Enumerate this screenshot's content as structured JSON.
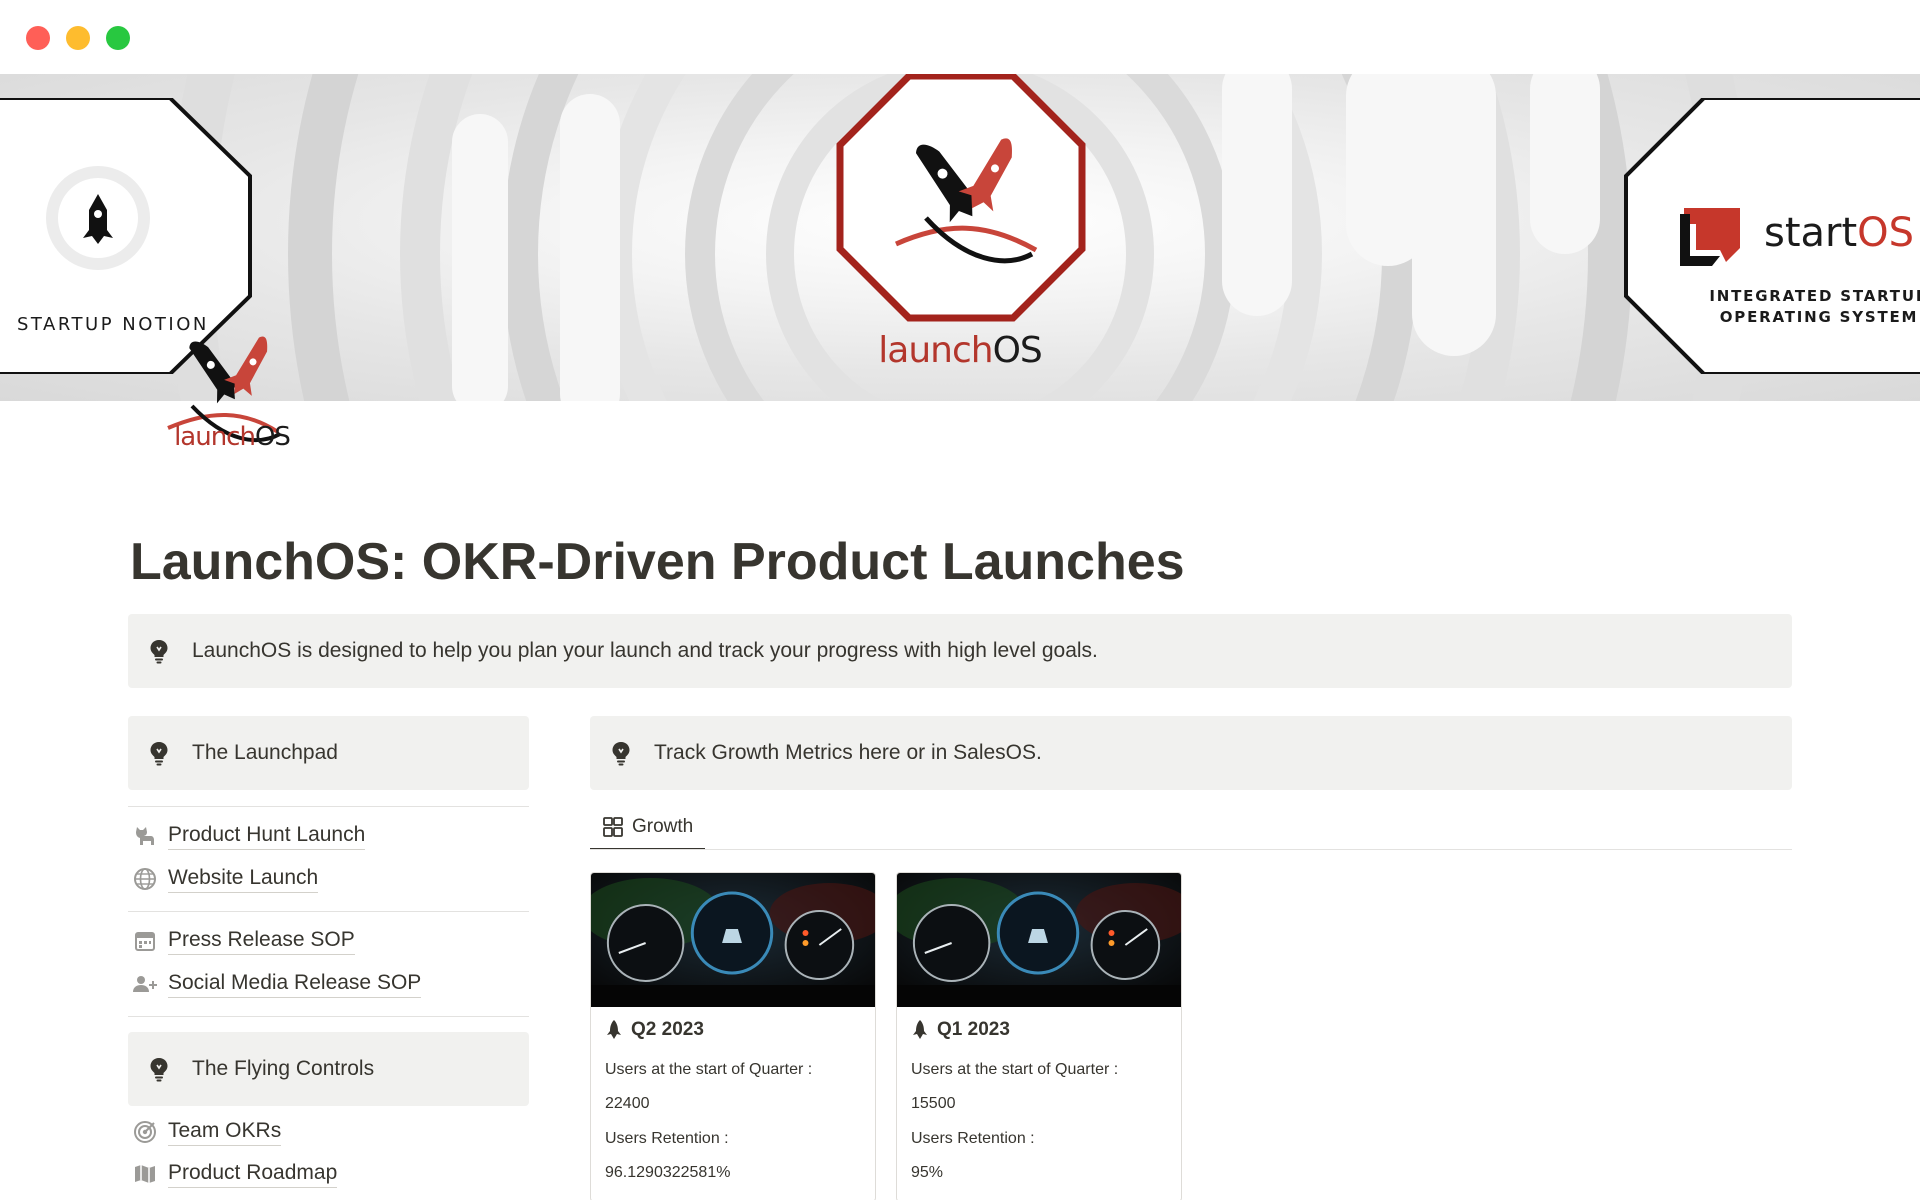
{
  "window": {
    "controls": [
      "close",
      "minimize",
      "maximize"
    ]
  },
  "cover": {
    "left_badge": {
      "text": "STARTUP NOTION"
    },
    "center_badge": {
      "word_launch": "launch",
      "word_os": "OS"
    },
    "right_badge": {
      "brand_start": "start",
      "brand_os": "OS",
      "subtitle_line1": "INTEGRATED STARTUP",
      "subtitle_line2": "OPERATING SYSTEM"
    }
  },
  "page_icon": {
    "word_launch": "launch",
    "word_os": "OS"
  },
  "page": {
    "title": "LaunchOS: OKR-Driven Product Launches",
    "intro_callout": "LaunchOS is designed to help you plan your launch and track your progress with high level goals."
  },
  "left_column": {
    "launchpad_callout": "The Launchpad",
    "group1": [
      {
        "label": "Product Hunt Launch",
        "icon": "cat-icon"
      },
      {
        "label": "Website Launch",
        "icon": "globe-icon"
      }
    ],
    "group2": [
      {
        "label": "Press Release SOP",
        "icon": "calendar-icon"
      },
      {
        "label": "Social Media Release SOP",
        "icon": "add-user-icon"
      }
    ],
    "flying_callout": "The Flying Controls",
    "group3": [
      {
        "label": "Team OKRs",
        "icon": "target-icon"
      },
      {
        "label": "Product Roadmap",
        "icon": "map-icon"
      }
    ]
  },
  "right_column": {
    "track_callout": "Track Growth Metrics here or in SalesOS.",
    "tabs": [
      {
        "label": "Growth",
        "icon": "gallery-icon",
        "active": true
      }
    ],
    "cards": [
      {
        "title": "Q2 2023",
        "prop1_label": "Users at the start of Quarter :",
        "prop1_value": "22400",
        "prop2_label": "Users Retention :",
        "prop2_value": "96.1290322581%"
      },
      {
        "title": "Q1 2023",
        "prop1_label": "Users at the start of Quarter :",
        "prop1_value": "15500",
        "prop2_label": "Users Retention :",
        "prop2_value": "95%"
      }
    ]
  },
  "colors": {
    "brand_red": "#b3362c",
    "callout_bg": "#f1f1ef",
    "text": "#37352f"
  }
}
